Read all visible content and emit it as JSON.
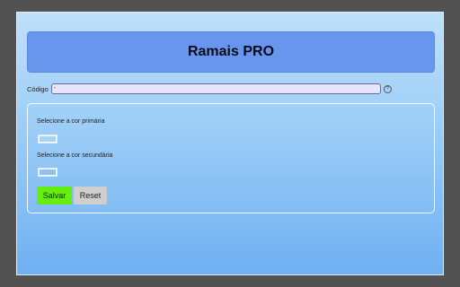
{
  "app": {
    "title": "Ramais PRO"
  },
  "code": {
    "label": "Código",
    "value": "-",
    "help_icon": "question-circle-icon"
  },
  "settings": {
    "primary_label": "Selecione a cor primária",
    "primary_color": "#a6d4f7",
    "secondary_label": "Selecione a cor secundária",
    "secondary_color": "#8ec0f2",
    "save_label": "Salvar",
    "reset_label": "Reset"
  },
  "colors": {
    "header_bg": "#6796ec",
    "page_bg": "#525252",
    "save_button": "#66ee10",
    "reset_button": "#cfcfcf"
  }
}
